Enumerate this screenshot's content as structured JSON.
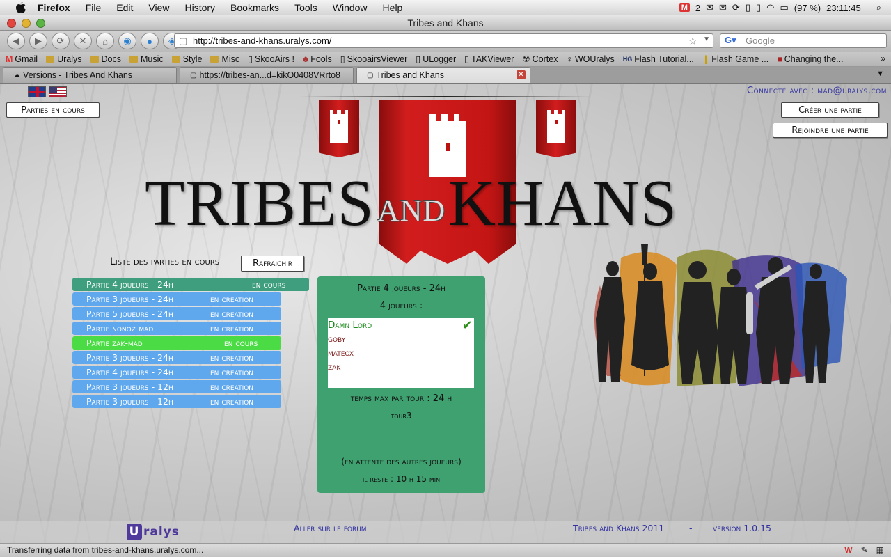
{
  "macmenu": {
    "app": "Firefox",
    "items": [
      "File",
      "Edit",
      "View",
      "History",
      "Bookmarks",
      "Tools",
      "Window",
      "Help"
    ],
    "mail_count": "2",
    "battery": "(97 %)",
    "clock": "23:11:45"
  },
  "window": {
    "title": "Tribes and Khans"
  },
  "browser": {
    "url": "http://tribes-and-khans.uralys.com/",
    "search_placeholder": "Google",
    "bookmarks": [
      "Gmail",
      "Uralys",
      "Docs",
      "Music",
      "Style",
      "Misc",
      "SkooAirs !",
      "Fools",
      "SkooairsViewer",
      "ULogger",
      "TAKViewer",
      "Cortex",
      "WOUralys",
      "Flash Tutorial...",
      "Flash Game ...",
      "Changing the..."
    ],
    "tabs": [
      {
        "label": "Versions - Tribes And Khans"
      },
      {
        "label": "https://tribes-an...d=kikO0408VRrto8"
      },
      {
        "label": "Tribes and Khans",
        "active": true
      }
    ],
    "status": "Transferring data from tribes-and-khans.uralys.com..."
  },
  "page": {
    "connected": "Connecté avec : mad@uralys.com",
    "btn_current": "Parties en cours",
    "btn_create": "Créer une partie",
    "btn_join": "Rejoindre une partie",
    "logo": {
      "left": "TRIBES",
      "and": "AND",
      "right": "KHANS"
    },
    "list_title": "Liste des parties en cours",
    "refresh": "Rafraichir",
    "games": [
      {
        "name": "Partie 4 joueurs - 24h",
        "status": "en cours",
        "style": "teal"
      },
      {
        "name": "Partie 3 joueurs - 24h",
        "status": "en creation",
        "style": "blue"
      },
      {
        "name": "Partie 5 joueurs - 24h",
        "status": "en creation",
        "style": "blue"
      },
      {
        "name": "Partie nonoz-mad",
        "status": "en creation",
        "style": "blue"
      },
      {
        "name": "Partie zak-mad",
        "status": "en cours",
        "style": "green"
      },
      {
        "name": "Partie 3 joueurs - 24h",
        "status": "en creation",
        "style": "blue"
      },
      {
        "name": "Partie 4 joueurs - 24h",
        "status": "en creation",
        "style": "blue"
      },
      {
        "name": "Partie 3 joueurs - 12h",
        "status": "en creation",
        "style": "blue"
      },
      {
        "name": "Partie 3 joueurs - 12h",
        "status": "en creation",
        "style": "blue"
      }
    ],
    "details": {
      "title": "Partie 4 joueurs - 24h",
      "players_count": "4 joueurs :",
      "players": [
        "Damn Lord",
        "goby",
        "mateox",
        "zak"
      ],
      "max_time": "temps max par tour : 24 h",
      "turn": "tour3",
      "waiting": "(en attente des autres joueurs)",
      "remaining": "il reste : 10 h 15 min"
    },
    "footer": {
      "brand": "ralys",
      "forum": "Aller sur le forum",
      "copyright": "Tribes and Khans 2011",
      "sep": "-",
      "version": "version 1.0.15"
    }
  }
}
